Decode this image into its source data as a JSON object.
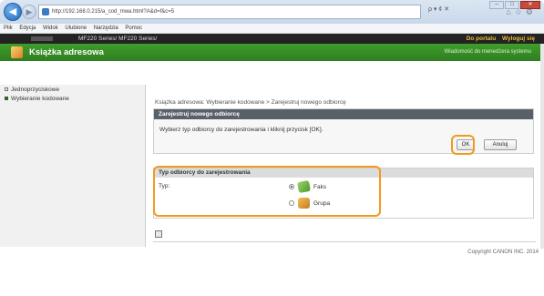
{
  "browser": {
    "url": "http://192.168.0.215/a_cod_mwa.html?A&d=f&c=5",
    "address_tools": "ρ ▾ ¢ ✕",
    "menu": [
      "Plik",
      "Edycja",
      "Widok",
      "Ulubione",
      "Narzędzia",
      "Pomoc"
    ]
  },
  "device_bar": {
    "model": "MF220 Series/ MF220 Series/",
    "links": [
      "Do portalu",
      "Wyloguj się"
    ]
  },
  "header": {
    "title": "Książka adresowa",
    "maintenance": "Wiadomość do menedżera systemu"
  },
  "sidebar": {
    "items": [
      {
        "label": "Jednoprzyciskowe",
        "bullet": "hollow"
      },
      {
        "label": "Wybieranie kodowane",
        "bullet": "solid"
      }
    ]
  },
  "main": {
    "breadcrumb": "Książka adresowa: Wybieranie kodowane > Zarejestruj nowego odbiorcę",
    "panel_title": "Zarejestruj nowego odbiorcę",
    "message": "Wybierz typ odbiorcy do zarejestrowania i kliknij przycisk [OK].",
    "ok_label": "OK",
    "cancel_label": "Anuluj",
    "type_section_title": "Typ odbiorcy do zarejestrowania",
    "type_label": "Typ:",
    "options": [
      {
        "label": "Faks",
        "selected": true,
        "icon": "fax-icon"
      },
      {
        "label": "Grupa",
        "selected": false,
        "icon": "group-icon"
      }
    ]
  },
  "footer": {
    "copyright": "Copyright CANON INC. 2014"
  },
  "colors": {
    "header_green": "#3f9d2c",
    "highlight_orange": "#f29a1e",
    "panel_head_gray": "#5a6069"
  }
}
